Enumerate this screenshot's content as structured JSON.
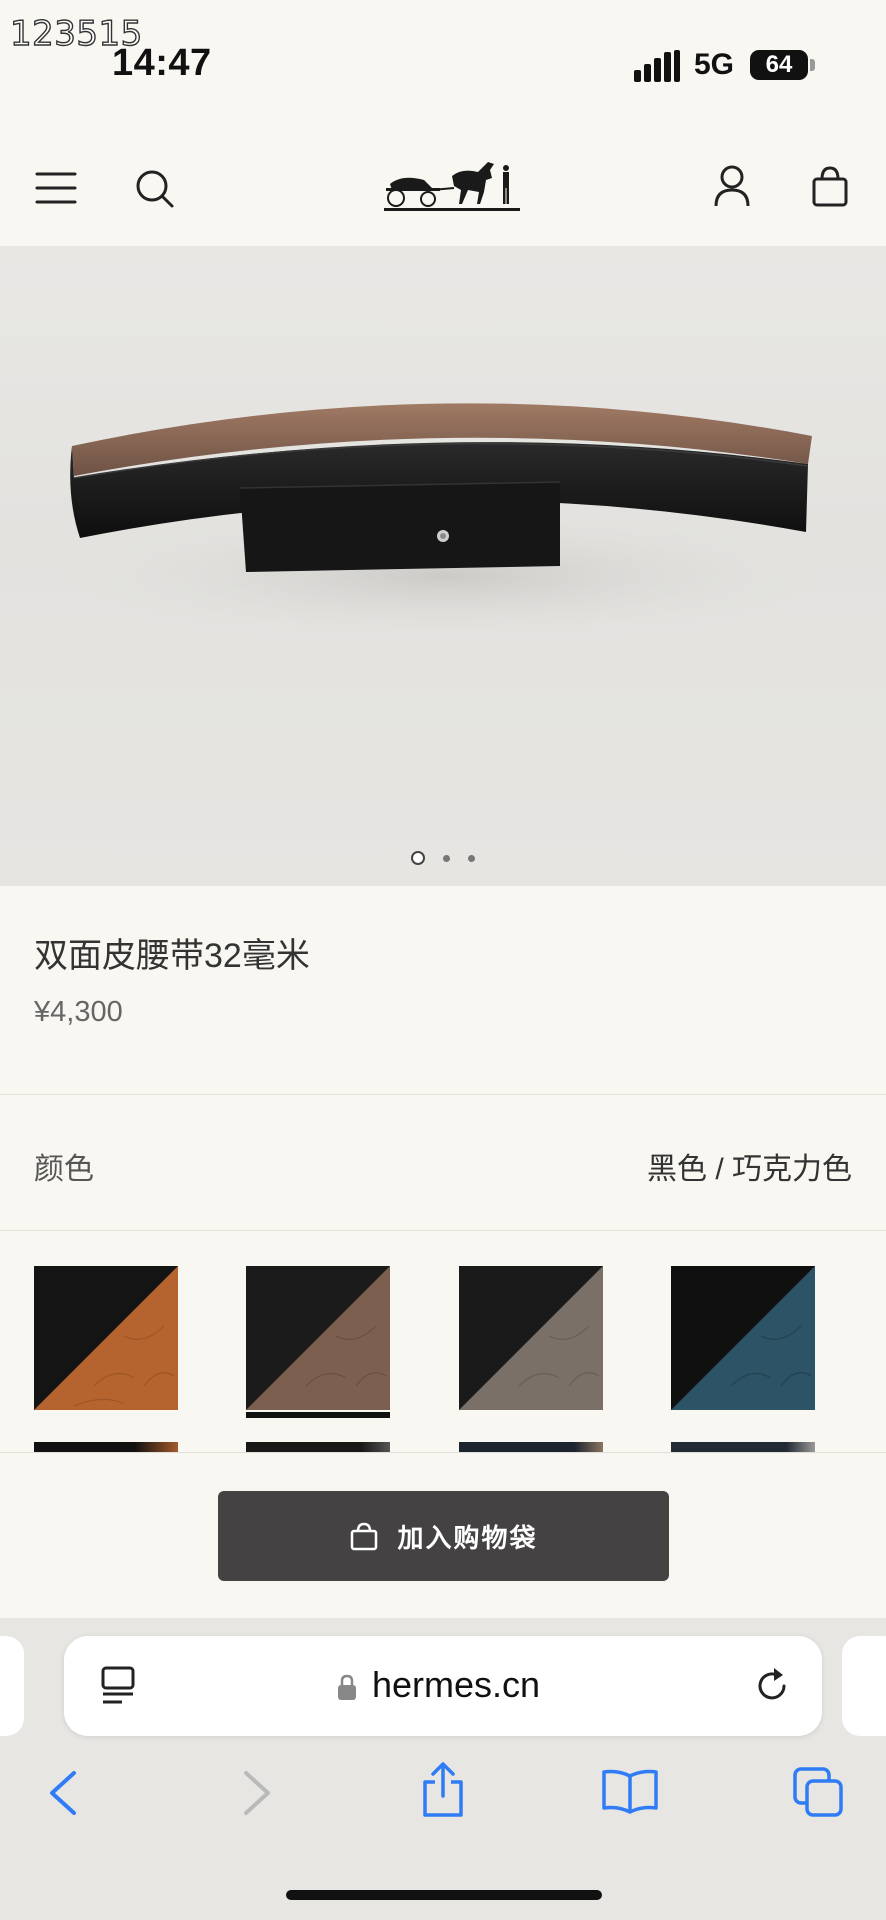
{
  "watermark": "123515",
  "status_bar": {
    "time": "14:47",
    "network": "5G",
    "battery": "64"
  },
  "header": {
    "menu_icon": "hamburger-icon",
    "search_icon": "search-icon",
    "logo": "Hermès carriage logo",
    "account_icon": "user-icon",
    "bag_icon": "shopping-bag-icon"
  },
  "carousel": {
    "page_count": 3,
    "active_index": 0
  },
  "product": {
    "title": "双面皮腰带32毫米",
    "price": "¥4,300"
  },
  "color_selector": {
    "label": "颜色",
    "selected": "黑色 / 巧克力色",
    "swatches": [
      {
        "name": "black-tan",
        "primary": "#141414",
        "secondary": "#b5642f",
        "selected": false
      },
      {
        "name": "black-chocolate",
        "primary": "#1b1b1b",
        "secondary": "#7d5f4f",
        "selected": true
      },
      {
        "name": "black-etoupe",
        "primary": "#1a1a1a",
        "secondary": "#7a7068",
        "selected": false
      },
      {
        "name": "black-teal",
        "primary": "#0f0f0f",
        "secondary": "#2d5366",
        "selected": false
      }
    ]
  },
  "cart_button": {
    "label": "加入购物袋",
    "icon": "shopping-bag-icon"
  },
  "browser": {
    "url": "hermes.cn",
    "reader_icon": "reader-icon",
    "lock_icon": "lock-icon",
    "reload_icon": "reload-icon",
    "toolbar_icons": [
      "back-icon",
      "forward-icon",
      "share-icon",
      "bookmarks-icon",
      "tabs-icon"
    ]
  },
  "colors": {
    "background": "#f8f7f2",
    "button": "#444242",
    "ios_blue": "#2f7cf6"
  }
}
